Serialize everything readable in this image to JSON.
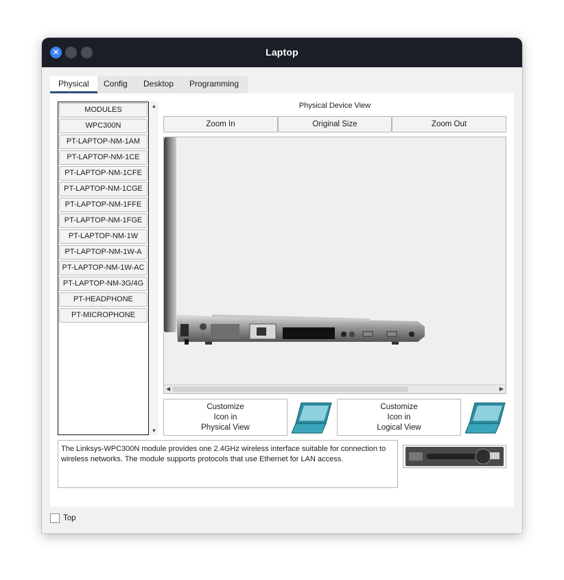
{
  "window": {
    "title": "Laptop"
  },
  "tabs": [
    {
      "label": "Physical",
      "active": true
    },
    {
      "label": "Config",
      "active": false
    },
    {
      "label": "Desktop",
      "active": false
    },
    {
      "label": "Programming",
      "active": false
    }
  ],
  "modules": {
    "header": "MODULES",
    "items": [
      "WPC300N",
      "PT-LAPTOP-NM-1AM",
      "PT-LAPTOP-NM-1CE",
      "PT-LAPTOP-NM-1CFE",
      "PT-LAPTOP-NM-1CGE",
      "PT-LAPTOP-NM-1FFE",
      "PT-LAPTOP-NM-1FGE",
      "PT-LAPTOP-NM-1W",
      "PT-LAPTOP-NM-1W-A",
      "PT-LAPTOP-NM-1W-AC",
      "PT-LAPTOP-NM-3G/4G",
      "PT-HEADPHONE",
      "PT-MICROPHONE"
    ]
  },
  "physical_view": {
    "label": "Physical Device View",
    "zoom_in": "Zoom In",
    "original_size": "Original Size",
    "zoom_out": "Zoom Out"
  },
  "customize": {
    "physical": [
      "Customize",
      "Icon in",
      "Physical View"
    ],
    "logical": [
      "Customize",
      "Icon in",
      "Logical View"
    ]
  },
  "description": "The Linksys-WPC300N module provides one 2.4GHz wireless interface suitable for connection to wireless networks. The module supports protocols that use Ethernet for LAN access.",
  "footer": {
    "top_label": "Top",
    "top_checked": false
  },
  "colors": {
    "titlebar": "#1b1e27",
    "close_button": "#3b82f6",
    "active_tab_underline": "#2b4f7a"
  }
}
